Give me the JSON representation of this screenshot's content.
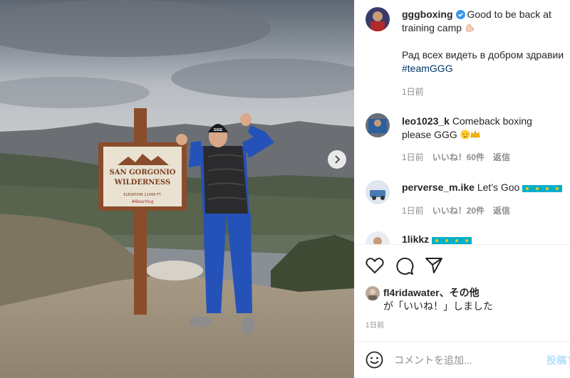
{
  "caption": {
    "username": "gggboxing",
    "text_line1": "Good to be back at",
    "text_line2": "training camp",
    "text_line3": "Рад всех видеть в добром здравии",
    "hashtag": "#teamGGG",
    "time": "1日前"
  },
  "sign": {
    "line1": "SAN GORGONIO",
    "line2": "WILDERNESS",
    "line3": "ELEVATION 11499 FT.",
    "line4": "#BearHug",
    "logo": "GGG"
  },
  "comments": [
    {
      "username": "leo1023_k",
      "text": "Comeback boxing",
      "text2": "please GGG",
      "time": "1日前",
      "likes": "いいね！60件",
      "reply": "返信"
    },
    {
      "username": "perverse_m.ike",
      "text": "Let's Goo",
      "time": "1日前",
      "likes": "いいね！20件",
      "reply": "返信"
    },
    {
      "username": "1likkz",
      "text": ""
    }
  ],
  "likes_summary": {
    "username": "fl4ridawater",
    "suffix": "、その他",
    "line2": "が「いいね！」しました"
  },
  "post_time": "1日前",
  "comment_box": {
    "placeholder": "コメントを追加...",
    "post_label": "投稿する"
  },
  "colors": {
    "link": "#00376b",
    "meta": "#8e8e8e",
    "verified": "#3897f0",
    "post_disabled": "#b2dffc"
  }
}
